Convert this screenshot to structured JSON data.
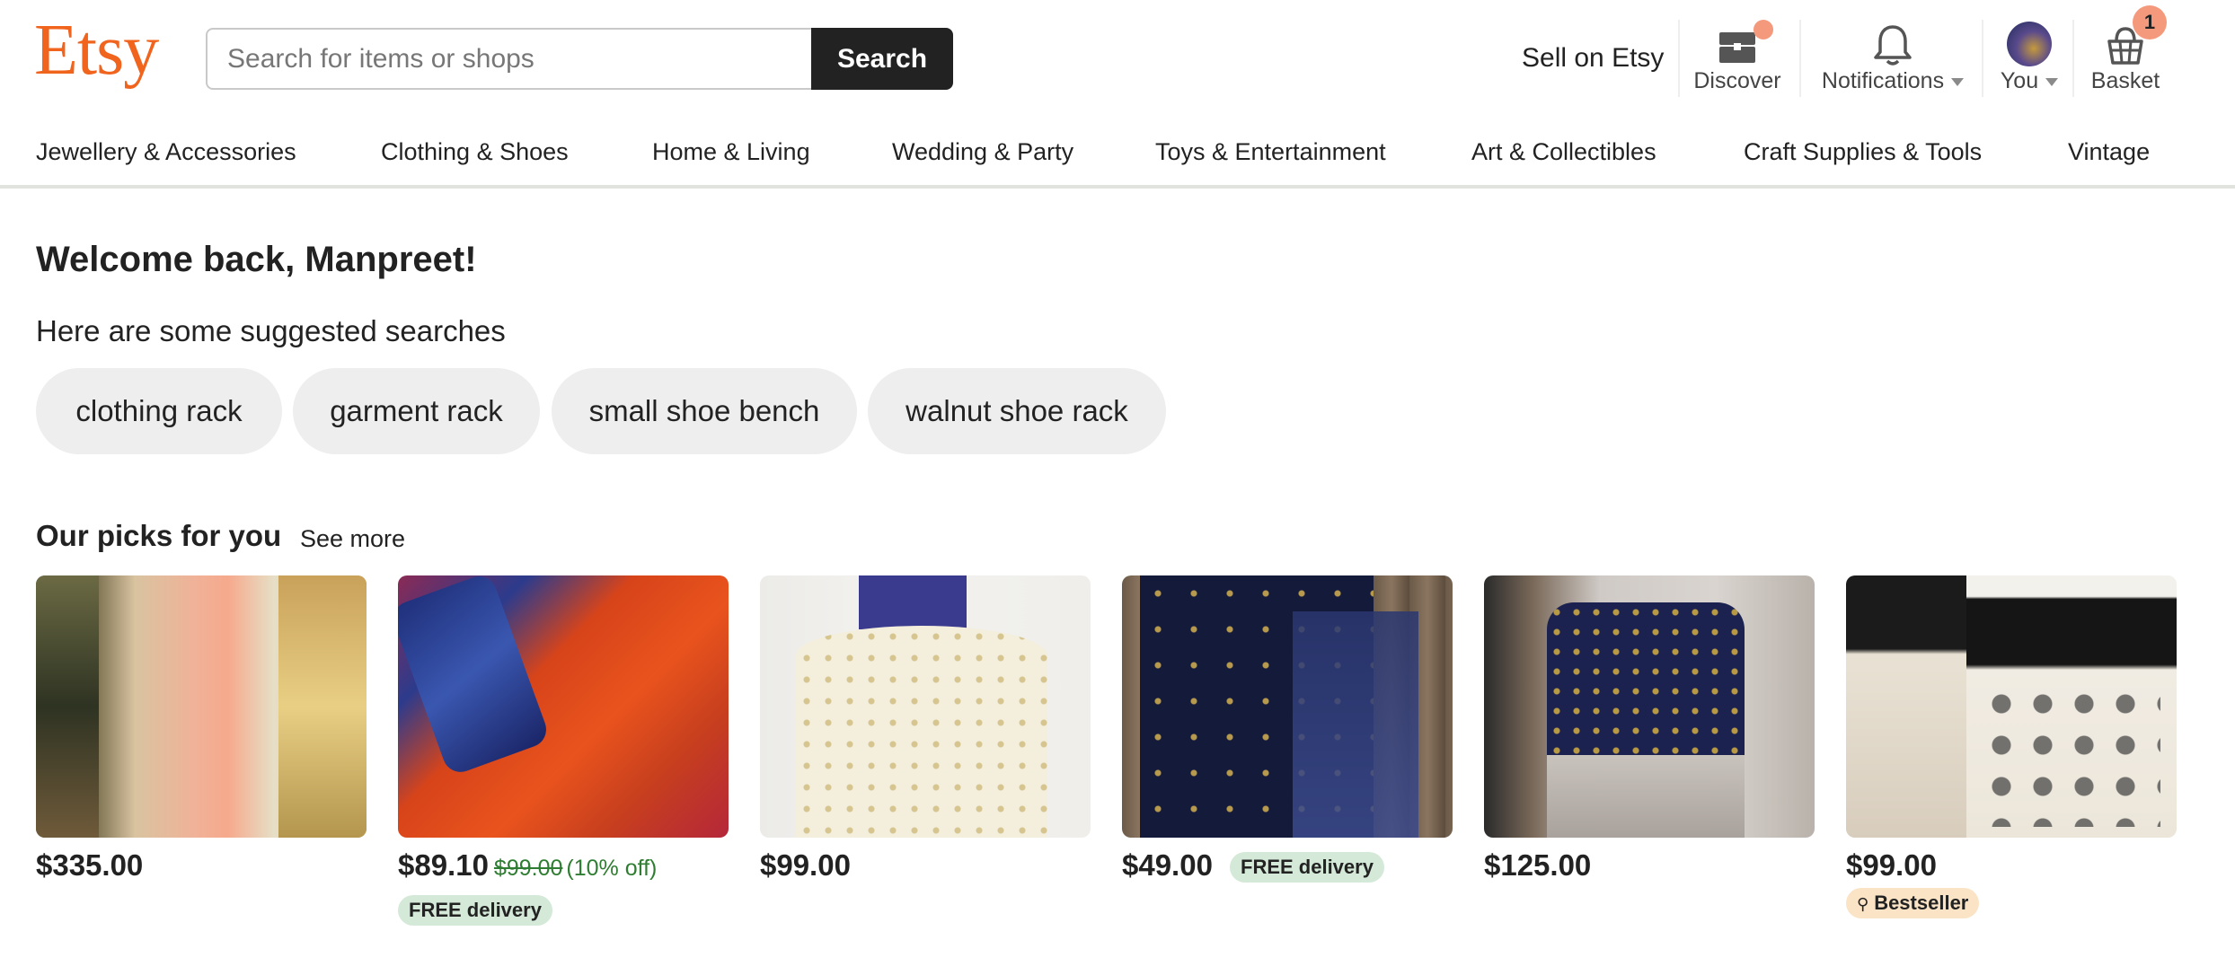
{
  "header": {
    "logo": "Etsy",
    "search_placeholder": "Search for items or shops",
    "search_button": "Search",
    "sell": "Sell on Etsy",
    "discover": "Discover",
    "notifications": "Notifications",
    "you": "You",
    "basket": "Basket",
    "basket_count": "1",
    "accent_color": "#F1641E"
  },
  "categories": [
    "Jewellery & Accessories",
    "Clothing & Shoes",
    "Home & Living",
    "Wedding & Party",
    "Toys & Entertainment",
    "Art & Collectibles",
    "Craft Supplies & Tools",
    "Vintage"
  ],
  "welcome": "Welcome back, Manpreet!",
  "suggested_title": "Here are some suggested searches",
  "suggestions": [
    "clothing rack",
    "garment rack",
    "small shoe bench",
    "walnut shoe rack"
  ],
  "picks": {
    "title": "Our picks for you",
    "see_more": "See more",
    "items": [
      {
        "price": "$335.00"
      },
      {
        "price": "$89.10",
        "original_price": "$99.00",
        "discount": "(10% off)",
        "badge": "FREE delivery"
      },
      {
        "price": "$99.00"
      },
      {
        "price": "$49.00",
        "badge": "FREE delivery"
      },
      {
        "price": "$125.00"
      },
      {
        "price": "$99.00",
        "badge": "Bestseller"
      }
    ]
  }
}
